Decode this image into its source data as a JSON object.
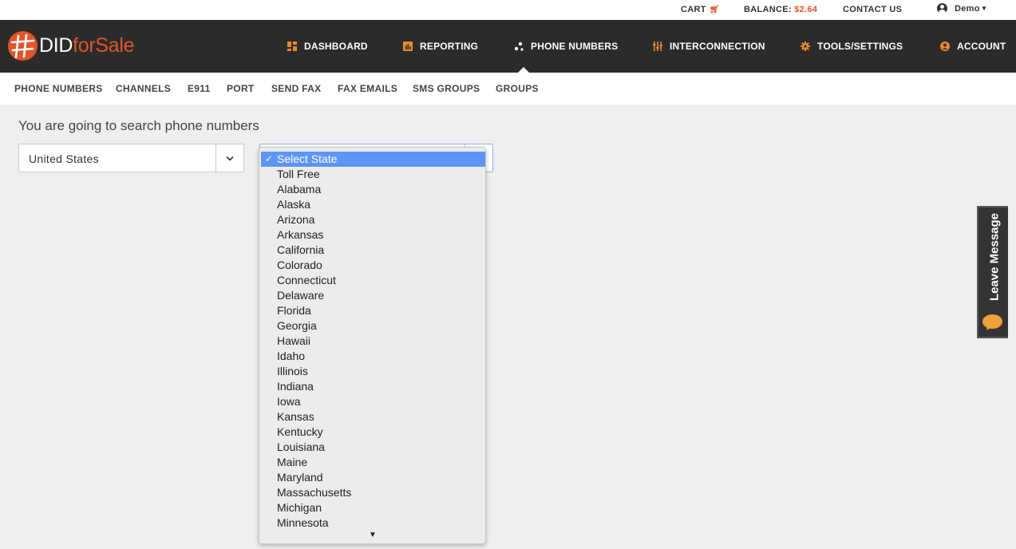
{
  "topbar": {
    "cart_label": "CART",
    "balance_label": "BALANCE:",
    "balance_amount": "$2.64",
    "contact_label": "CONTACT US",
    "user_name": "Demo"
  },
  "brand": {
    "logo_main": "DID",
    "logo_accent": "forSale"
  },
  "main_nav": {
    "items": [
      {
        "label": "DASHBOARD",
        "icon": "dashboard-icon"
      },
      {
        "label": "REPORTING",
        "icon": "bar-chart-icon"
      },
      {
        "label": "PHONE NUMBERS",
        "icon": "network-icon",
        "active": true
      },
      {
        "label": "INTERCONNECTION",
        "icon": "sliders-icon"
      },
      {
        "label": "TOOLS/SETTINGS",
        "icon": "gear-icon"
      },
      {
        "label": "ACCOUNT",
        "icon": "user-icon"
      }
    ]
  },
  "sub_nav": {
    "items": [
      "PHONE NUMBERS",
      "CHANNELS",
      "E911",
      "PORT",
      "SEND FAX",
      "FAX EMAILS",
      "SMS GROUPS",
      "GROUPS"
    ]
  },
  "search": {
    "heading": "You are going to search phone numbers",
    "country_value": "United States"
  },
  "state_dropdown": {
    "selected": "Select State",
    "options": [
      "Select State",
      "Toll Free",
      "Alabama",
      "Alaska",
      "Arizona",
      "Arkansas",
      "California",
      "Colorado",
      "Connecticut",
      "Delaware",
      "Florida",
      "Georgia",
      "Hawaii",
      "Idaho",
      "Illinois",
      "Indiana",
      "Iowa",
      "Kansas",
      "Kentucky",
      "Louisiana",
      "Maine",
      "Maryland",
      "Massachusetts",
      "Michigan",
      "Minnesota"
    ]
  },
  "widget": {
    "leave_message_label": "Leave Message"
  },
  "colors": {
    "accent": "#e0562a",
    "nav_bg": "#2b2b2b",
    "selected_option": "#5d95f5"
  }
}
